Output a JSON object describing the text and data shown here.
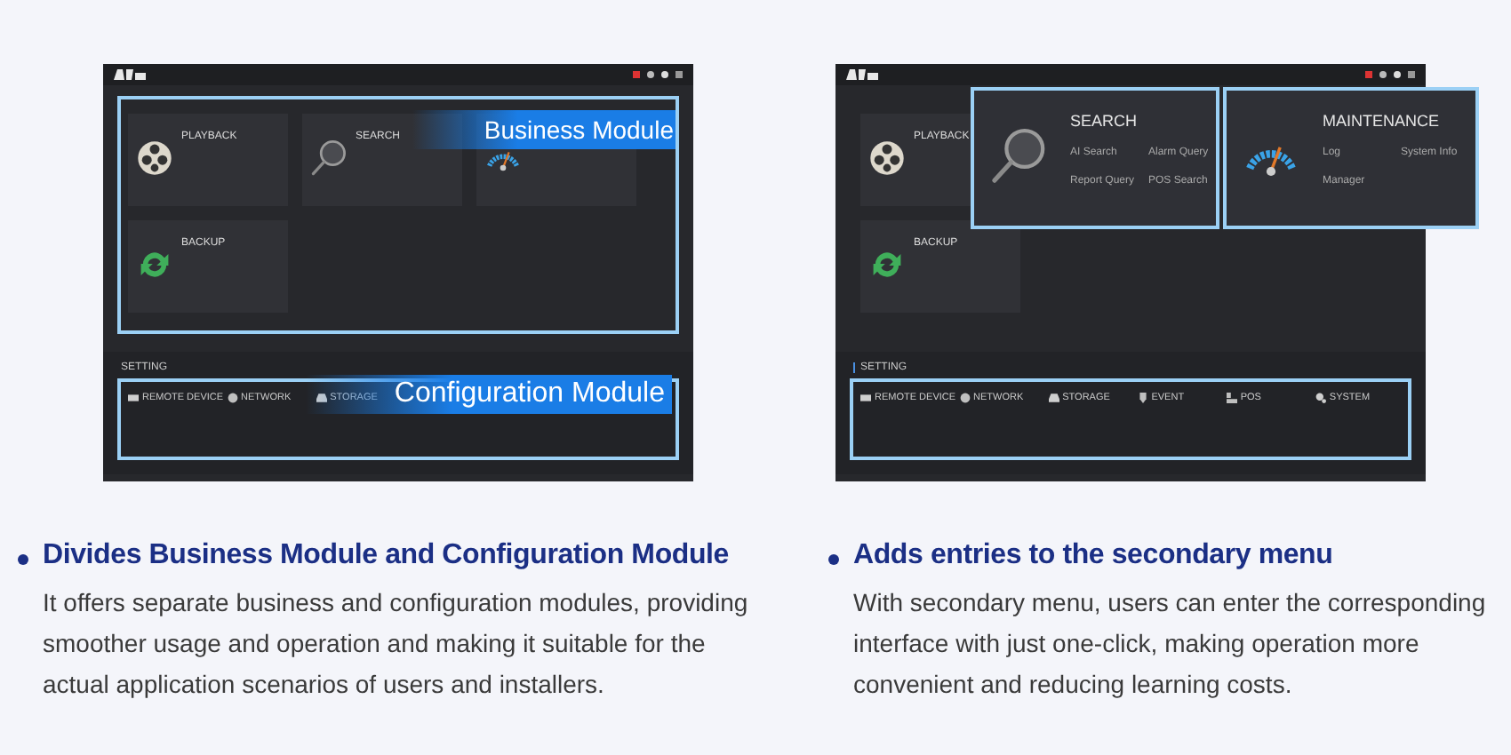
{
  "panels": [
    {
      "business_highlighted": true,
      "business_callout": "Business Module",
      "cards": [
        {
          "kind": "playback",
          "title": "PLAYBACK"
        },
        {
          "kind": "search",
          "title": "SEARCH"
        },
        {
          "kind": "maintenance"
        },
        {
          "kind": "backup",
          "title": "BACKUP"
        }
      ],
      "settings": {
        "title": "SETTING",
        "highlighted": true,
        "callout": "Configuration Module",
        "groups": [
          {
            "title": "REMOTE DEVICE"
          },
          {
            "title": "NETWORK"
          },
          {
            "title": "STORAGE"
          }
        ]
      }
    },
    {
      "business_highlighted": false,
      "cards": [
        {
          "kind": "playback",
          "title": "PLAYBACK"
        },
        {
          "kind": "backup",
          "title": "BACKUP"
        }
      ],
      "settings": {
        "title": "SETTING",
        "highlighted": true,
        "groups": [
          {
            "title": "REMOTE DEVICE"
          },
          {
            "title": "NETWORK"
          },
          {
            "title": "STORAGE"
          },
          {
            "title": "EVENT"
          },
          {
            "title": "POS"
          },
          {
            "title": "SYSTEM"
          }
        ]
      },
      "popups": [
        {
          "kind": "search",
          "title": "SEARCH",
          "items": [
            "AI Search",
            "Alarm Query",
            "Report Query",
            "POS Search"
          ]
        },
        {
          "kind": "maintenance",
          "title": "MAINTENANCE",
          "items": [
            "Log",
            "System Info",
            "Manager"
          ]
        }
      ]
    }
  ],
  "features": [
    {
      "heading": "Divides Business Module and Configuration Module",
      "body": "It offers separate business and configuration modules, providing smoother usage and operation and making it suitable for the actual application scenarios of users and installers."
    },
    {
      "heading": "Adds entries to the secondary menu",
      "body": "With secondary menu, users can enter the corresponding interface with just one-click, making operation more convenient and reducing learning costs."
    }
  ]
}
